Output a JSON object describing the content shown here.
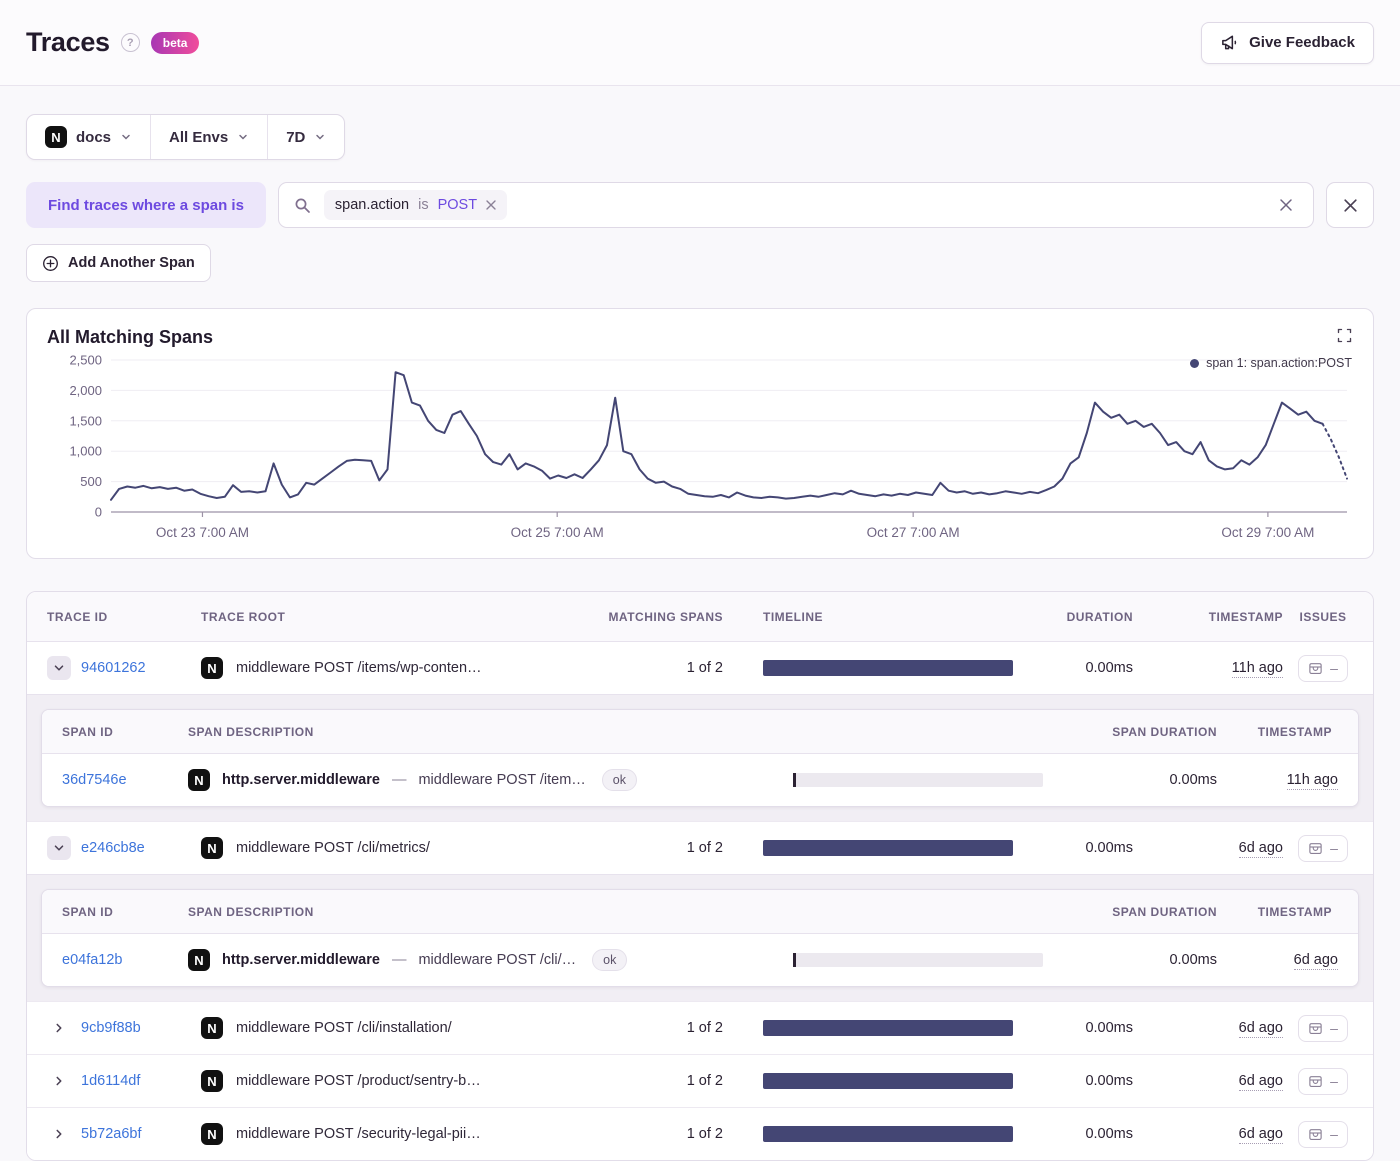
{
  "header": {
    "title": "Traces",
    "beta_label": "beta",
    "feedback_label": "Give Feedback"
  },
  "filters": {
    "project": "docs",
    "environment": "All Envs",
    "period": "7D"
  },
  "search": {
    "label": "Find traces where a span is",
    "token": {
      "key": "span.action",
      "op": "is",
      "value": "POST"
    },
    "add_span_label": "Add Another Span"
  },
  "chart": {
    "title": "All Matching Spans",
    "legend": "span 1: span.action:POST"
  },
  "chart_data": {
    "type": "line",
    "title": "All Matching Spans",
    "xlabel": "",
    "ylabel": "",
    "grid": "horizontal",
    "legend_position": "top-right",
    "y_axis": {
      "min": 0,
      "max": 2500,
      "ticks": [
        0,
        500,
        1000,
        1500,
        2000,
        2500
      ],
      "tick_labels": [
        "0",
        "500",
        "1,000",
        "1,500",
        "2,000",
        "2,500"
      ]
    },
    "x_axis": {
      "tick_labels": [
        "Oct 23 7:00 AM",
        "Oct 25 7:00 AM",
        "Oct 27 7:00 AM",
        "Oct 29 7:00 AM"
      ],
      "tick_positions": [
        0.074,
        0.361,
        0.649,
        0.936
      ]
    },
    "series": [
      {
        "name": "span 1: span.action:POST",
        "color": "#444674",
        "dashed_tail_points": 3,
        "values": [
          200,
          380,
          420,
          400,
          430,
          390,
          410,
          380,
          400,
          350,
          370,
          300,
          260,
          230,
          250,
          440,
          330,
          340,
          320,
          340,
          800,
          450,
          240,
          290,
          480,
          450,
          550,
          650,
          750,
          840,
          860,
          850,
          840,
          520,
          700,
          2300,
          2250,
          1800,
          1750,
          1500,
          1350,
          1300,
          1600,
          1660,
          1450,
          1250,
          950,
          820,
          780,
          950,
          700,
          800,
          750,
          680,
          550,
          600,
          560,
          620,
          560,
          700,
          850,
          1100,
          1880,
          1000,
          950,
          700,
          550,
          480,
          500,
          420,
          380,
          300,
          280,
          260,
          250,
          280,
          240,
          320,
          270,
          240,
          230,
          250,
          240,
          220,
          230,
          250,
          270,
          250,
          280,
          310,
          290,
          350,
          300,
          280,
          260,
          290,
          270,
          300,
          280,
          320,
          300,
          280,
          480,
          350,
          320,
          340,
          300,
          320,
          290,
          310,
          340,
          320,
          300,
          330,
          310,
          360,
          420,
          550,
          800,
          900,
          1300,
          1800,
          1650,
          1550,
          1600,
          1450,
          1500,
          1400,
          1450,
          1300,
          1100,
          1150,
          1000,
          950,
          1150,
          850,
          750,
          700,
          720,
          850,
          780,
          900,
          1100,
          1450,
          1800,
          1700,
          1600,
          1650,
          1500,
          1450,
          1200,
          900,
          550
        ]
      }
    ]
  },
  "colors": {
    "accent_purple": "#6D4AE0",
    "link_blue": "#3D74DB",
    "chart_navy": "#444674",
    "beta_gradient_start": "#A737B4",
    "beta_gradient_end": "#F14D9B"
  },
  "table": {
    "columns": [
      "TRACE ID",
      "TRACE ROOT",
      "MATCHING SPANS",
      "TIMELINE",
      "DURATION",
      "TIMESTAMP",
      "ISSUES"
    ],
    "span_columns": [
      "SPAN ID",
      "SPAN DESCRIPTION",
      "SPAN DURATION",
      "TIMESTAMP"
    ],
    "rows": [
      {
        "trace_id": "94601262",
        "expanded": true,
        "root": "middleware POST /items/wp-conten…",
        "matching": "1 of 2",
        "duration": "0.00ms",
        "timestamp": "11h ago",
        "spans": [
          {
            "span_id": "36d7546e",
            "op": "http.server.middleware",
            "description": "middleware POST /item…",
            "status": "ok",
            "duration": "0.00ms",
            "timestamp": "11h ago"
          }
        ]
      },
      {
        "trace_id": "e246cb8e",
        "expanded": true,
        "root": "middleware POST /cli/metrics/",
        "matching": "1 of 2",
        "duration": "0.00ms",
        "timestamp": "6d ago",
        "spans": [
          {
            "span_id": "e04fa12b",
            "op": "http.server.middleware",
            "description": "middleware POST /cli/…",
            "status": "ok",
            "duration": "0.00ms",
            "timestamp": "6d ago"
          }
        ]
      },
      {
        "trace_id": "9cb9f88b",
        "expanded": false,
        "root": "middleware POST /cli/installation/",
        "matching": "1 of 2",
        "duration": "0.00ms",
        "timestamp": "6d ago",
        "spans": []
      },
      {
        "trace_id": "1d6114df",
        "expanded": false,
        "root": "middleware POST /product/sentry-b…",
        "matching": "1 of 2",
        "duration": "0.00ms",
        "timestamp": "6d ago",
        "spans": []
      },
      {
        "trace_id": "5b72a6bf",
        "expanded": false,
        "root": "middleware POST /security-legal-pii…",
        "matching": "1 of 2",
        "duration": "0.00ms",
        "timestamp": "6d ago",
        "spans": []
      }
    ]
  }
}
